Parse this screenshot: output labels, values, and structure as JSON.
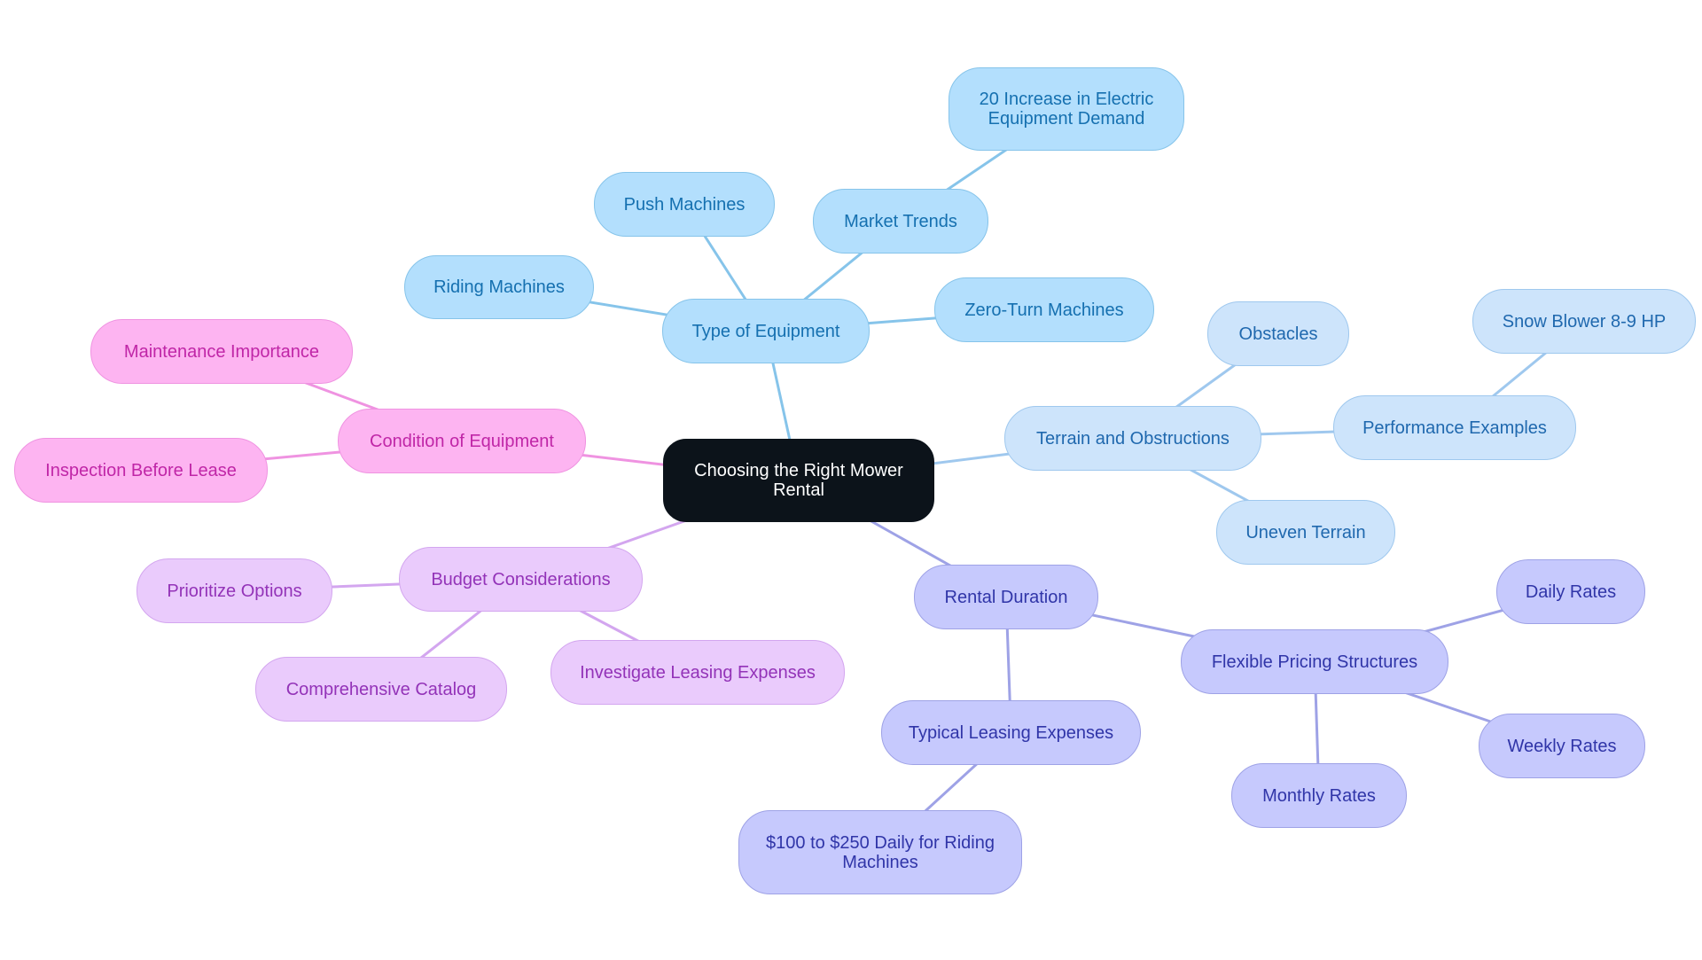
{
  "title": "Choosing the Right Mower Rental",
  "colors": {
    "equipment": "#86c4ea",
    "terrain": "#9fc8ee",
    "rental": "#9ea2e6",
    "budget": "#d3a6ef",
    "condition": "#ef93e1"
  },
  "nodes": {
    "root": "Choosing the Right Mower Rental",
    "type_of_equipment": "Type of Equipment",
    "riding_machines": "Riding Machines",
    "push_machines": "Push Machines",
    "market_trends": "Market Trends",
    "electric_demand": "20 Increase in Electric Equipment Demand",
    "zero_turn": "Zero-Turn Machines",
    "terrain": "Terrain and Obstructions",
    "obstacles": "Obstacles",
    "performance_examples": "Performance Examples",
    "snow_blower": "Snow Blower 8-9 HP",
    "uneven_terrain": "Uneven Terrain",
    "rental_duration": "Rental Duration",
    "flexible_pricing": "Flexible Pricing Structures",
    "daily_rates": "Daily Rates",
    "weekly_rates": "Weekly Rates",
    "monthly_rates": "Monthly Rates",
    "typical_leasing": "Typical Leasing Expenses",
    "riding_cost": "$100 to $250 Daily for Riding Machines",
    "budget": "Budget Considerations",
    "prioritize": "Prioritize Options",
    "catalog": "Comprehensive Catalog",
    "investigate": "Investigate Leasing Expenses",
    "condition": "Condition of Equipment",
    "maintenance": "Maintenance Importance",
    "inspection": "Inspection Before Lease"
  },
  "edges": [
    [
      "root",
      "type_of_equipment",
      "equipment"
    ],
    [
      "type_of_equipment",
      "riding_machines",
      "equipment"
    ],
    [
      "type_of_equipment",
      "push_machines",
      "equipment"
    ],
    [
      "type_of_equipment",
      "market_trends",
      "equipment"
    ],
    [
      "market_trends",
      "electric_demand",
      "equipment"
    ],
    [
      "type_of_equipment",
      "zero_turn",
      "equipment"
    ],
    [
      "root",
      "terrain",
      "terrain"
    ],
    [
      "terrain",
      "obstacles",
      "terrain"
    ],
    [
      "terrain",
      "performance_examples",
      "terrain"
    ],
    [
      "performance_examples",
      "snow_blower",
      "terrain"
    ],
    [
      "terrain",
      "uneven_terrain",
      "terrain"
    ],
    [
      "root",
      "rental_duration",
      "rental"
    ],
    [
      "rental_duration",
      "flexible_pricing",
      "rental"
    ],
    [
      "flexible_pricing",
      "daily_rates",
      "rental"
    ],
    [
      "flexible_pricing",
      "weekly_rates",
      "rental"
    ],
    [
      "flexible_pricing",
      "monthly_rates",
      "rental"
    ],
    [
      "rental_duration",
      "typical_leasing",
      "rental"
    ],
    [
      "typical_leasing",
      "riding_cost",
      "rental"
    ],
    [
      "root",
      "budget",
      "budget"
    ],
    [
      "budget",
      "prioritize",
      "budget"
    ],
    [
      "budget",
      "catalog",
      "budget"
    ],
    [
      "budget",
      "investigate",
      "budget"
    ],
    [
      "root",
      "condition",
      "condition"
    ],
    [
      "condition",
      "maintenance",
      "condition"
    ],
    [
      "condition",
      "inspection",
      "condition"
    ]
  ]
}
